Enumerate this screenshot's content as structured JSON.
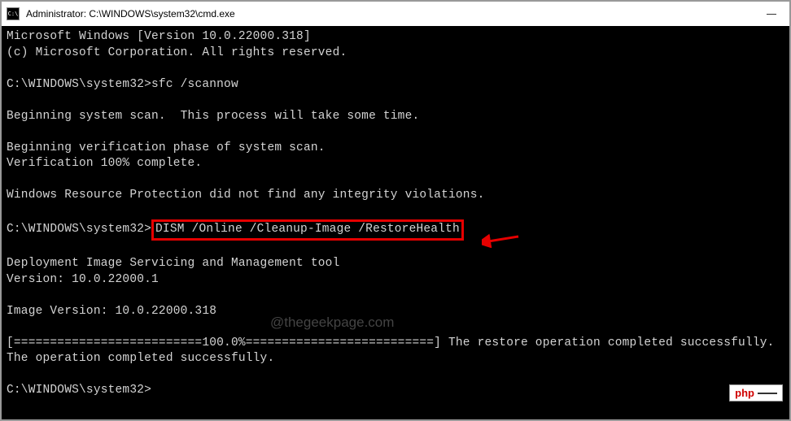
{
  "title_bar": {
    "icon_text": "C:\\",
    "title": "Administrator: C:\\WINDOWS\\system32\\cmd.exe"
  },
  "terminal": {
    "line_version": "Microsoft Windows [Version 10.0.22000.318]",
    "line_copyright": "(c) Microsoft Corporation. All rights reserved.",
    "prompt1_path": "C:\\WINDOWS\\system32>",
    "prompt1_cmd": "sfc /scannow",
    "line_scan_begin": "Beginning system scan.  This process will take some time.",
    "line_verif_begin": "Beginning verification phase of system scan.",
    "line_verif_done": "Verification 100% complete.",
    "line_wrp": "Windows Resource Protection did not find any integrity violations.",
    "prompt2_path": "C:\\WINDOWS\\system32>",
    "prompt2_cmd": "DISM /Online /Cleanup-Image /RestoreHealth",
    "line_dism_tool": "Deployment Image Servicing and Management tool",
    "line_dism_ver": "Version: 10.0.22000.1",
    "line_image_ver": "Image Version: 10.0.22000.318",
    "line_progress": "[==========================100.0%==========================] The restore operation completed successfully.",
    "line_op_done": "The operation completed successfully.",
    "prompt3_path": "C:\\WINDOWS\\system32>"
  },
  "watermark": "@thegeekpage.com",
  "badge": {
    "php": "php",
    "cn": " "
  }
}
